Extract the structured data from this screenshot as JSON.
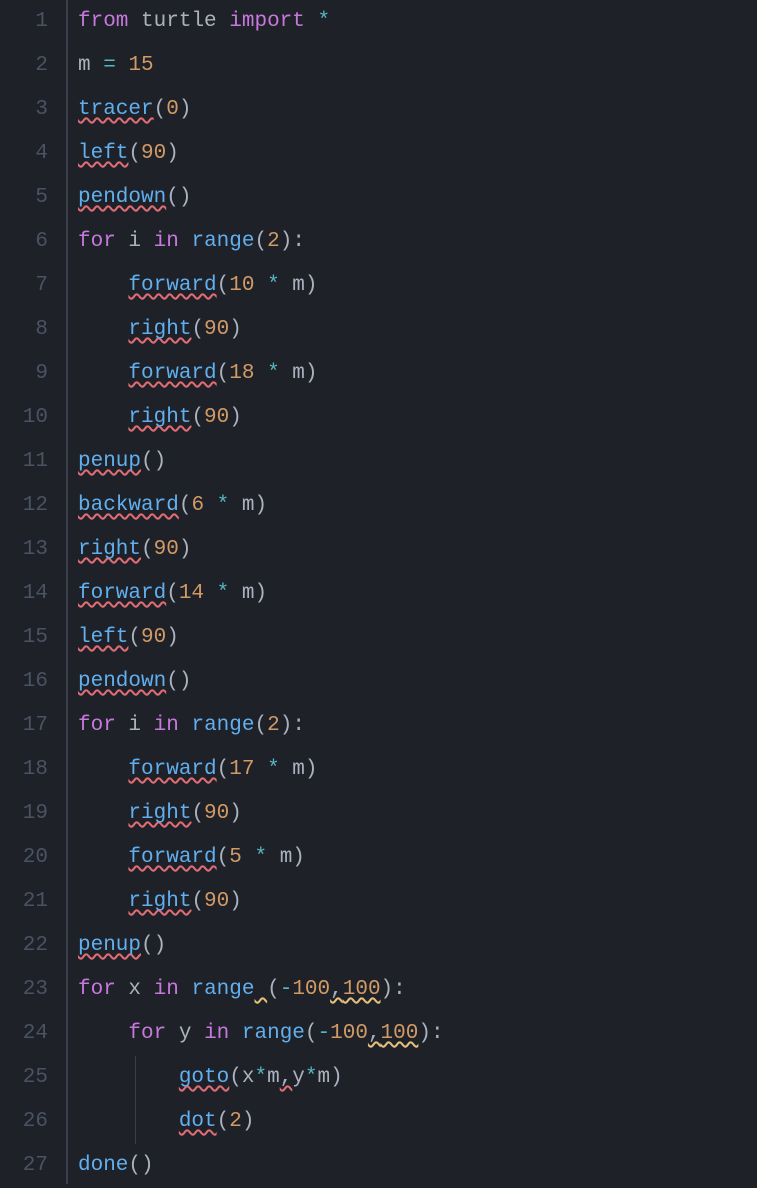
{
  "line_count": 27,
  "lines": {
    "1": {
      "tokens": [
        {
          "t": "from",
          "c": "kw"
        },
        {
          "t": " ",
          "c": "id"
        },
        {
          "t": "turtle",
          "c": "id"
        },
        {
          "t": " ",
          "c": "id"
        },
        {
          "t": "import",
          "c": "kw"
        },
        {
          "t": " ",
          "c": "id"
        },
        {
          "t": "*",
          "c": "op"
        }
      ]
    },
    "2": {
      "tokens": [
        {
          "t": "m",
          "c": "id"
        },
        {
          "t": " ",
          "c": "id"
        },
        {
          "t": "=",
          "c": "op"
        },
        {
          "t": " ",
          "c": "id"
        },
        {
          "t": "15",
          "c": "num"
        }
      ]
    },
    "3": {
      "tokens": [
        {
          "t": "tracer",
          "c": "fn",
          "sq": "red"
        },
        {
          "t": "(",
          "c": "punc"
        },
        {
          "t": "0",
          "c": "num"
        },
        {
          "t": ")",
          "c": "punc"
        }
      ]
    },
    "4": {
      "tokens": [
        {
          "t": "left",
          "c": "fn",
          "sq": "red"
        },
        {
          "t": "(",
          "c": "punc"
        },
        {
          "t": "90",
          "c": "num"
        },
        {
          "t": ")",
          "c": "punc"
        }
      ]
    },
    "5": {
      "tokens": [
        {
          "t": "pendown",
          "c": "fn",
          "sq": "red"
        },
        {
          "t": "(",
          "c": "punc"
        },
        {
          "t": ")",
          "c": "punc"
        }
      ]
    },
    "6": {
      "tokens": [
        {
          "t": "for",
          "c": "kw"
        },
        {
          "t": " ",
          "c": "id"
        },
        {
          "t": "i",
          "c": "id"
        },
        {
          "t": " ",
          "c": "id"
        },
        {
          "t": "in",
          "c": "kw"
        },
        {
          "t": " ",
          "c": "id"
        },
        {
          "t": "range",
          "c": "fn"
        },
        {
          "t": "(",
          "c": "punc"
        },
        {
          "t": "2",
          "c": "num"
        },
        {
          "t": ")",
          "c": "punc"
        },
        {
          "t": ":",
          "c": "punc"
        }
      ]
    },
    "7": {
      "indent": 1,
      "tokens": [
        {
          "t": "forward",
          "c": "fn",
          "sq": "red"
        },
        {
          "t": "(",
          "c": "punc"
        },
        {
          "t": "10",
          "c": "num"
        },
        {
          "t": " ",
          "c": "id"
        },
        {
          "t": "*",
          "c": "op"
        },
        {
          "t": " ",
          "c": "id"
        },
        {
          "t": "m",
          "c": "id"
        },
        {
          "t": ")",
          "c": "punc"
        }
      ]
    },
    "8": {
      "indent": 1,
      "tokens": [
        {
          "t": "right",
          "c": "fn",
          "sq": "red"
        },
        {
          "t": "(",
          "c": "punc"
        },
        {
          "t": "90",
          "c": "num"
        },
        {
          "t": ")",
          "c": "punc"
        }
      ]
    },
    "9": {
      "indent": 1,
      "tokens": [
        {
          "t": "forward",
          "c": "fn",
          "sq": "red"
        },
        {
          "t": "(",
          "c": "punc"
        },
        {
          "t": "18",
          "c": "num"
        },
        {
          "t": " ",
          "c": "id"
        },
        {
          "t": "*",
          "c": "op"
        },
        {
          "t": " ",
          "c": "id"
        },
        {
          "t": "m",
          "c": "id"
        },
        {
          "t": ")",
          "c": "punc"
        }
      ]
    },
    "10": {
      "indent": 1,
      "tokens": [
        {
          "t": "right",
          "c": "fn",
          "sq": "red"
        },
        {
          "t": "(",
          "c": "punc"
        },
        {
          "t": "90",
          "c": "num"
        },
        {
          "t": ")",
          "c": "punc"
        }
      ]
    },
    "11": {
      "tokens": [
        {
          "t": "penup",
          "c": "fn",
          "sq": "red"
        },
        {
          "t": "(",
          "c": "punc"
        },
        {
          "t": ")",
          "c": "punc"
        }
      ]
    },
    "12": {
      "tokens": [
        {
          "t": "backward",
          "c": "fn",
          "sq": "red"
        },
        {
          "t": "(",
          "c": "punc"
        },
        {
          "t": "6",
          "c": "num"
        },
        {
          "t": " ",
          "c": "id"
        },
        {
          "t": "*",
          "c": "op"
        },
        {
          "t": " ",
          "c": "id"
        },
        {
          "t": "m",
          "c": "id"
        },
        {
          "t": ")",
          "c": "punc"
        }
      ]
    },
    "13": {
      "tokens": [
        {
          "t": "right",
          "c": "fn",
          "sq": "red"
        },
        {
          "t": "(",
          "c": "punc"
        },
        {
          "t": "90",
          "c": "num"
        },
        {
          "t": ")",
          "c": "punc"
        }
      ]
    },
    "14": {
      "tokens": [
        {
          "t": "forward",
          "c": "fn",
          "sq": "red"
        },
        {
          "t": "(",
          "c": "punc"
        },
        {
          "t": "14",
          "c": "num"
        },
        {
          "t": " ",
          "c": "id"
        },
        {
          "t": "*",
          "c": "op"
        },
        {
          "t": " ",
          "c": "id"
        },
        {
          "t": "m",
          "c": "id"
        },
        {
          "t": ")",
          "c": "punc"
        }
      ]
    },
    "15": {
      "tokens": [
        {
          "t": "left",
          "c": "fn",
          "sq": "red"
        },
        {
          "t": "(",
          "c": "punc"
        },
        {
          "t": "90",
          "c": "num"
        },
        {
          "t": ")",
          "c": "punc"
        }
      ]
    },
    "16": {
      "tokens": [
        {
          "t": "pendown",
          "c": "fn",
          "sq": "red"
        },
        {
          "t": "(",
          "c": "punc"
        },
        {
          "t": ")",
          "c": "punc"
        }
      ]
    },
    "17": {
      "tokens": [
        {
          "t": "for",
          "c": "kw"
        },
        {
          "t": " ",
          "c": "id"
        },
        {
          "t": "i",
          "c": "id"
        },
        {
          "t": " ",
          "c": "id"
        },
        {
          "t": "in",
          "c": "kw"
        },
        {
          "t": " ",
          "c": "id"
        },
        {
          "t": "range",
          "c": "fn"
        },
        {
          "t": "(",
          "c": "punc"
        },
        {
          "t": "2",
          "c": "num"
        },
        {
          "t": ")",
          "c": "punc"
        },
        {
          "t": ":",
          "c": "punc"
        }
      ]
    },
    "18": {
      "indent": 1,
      "tokens": [
        {
          "t": "forward",
          "c": "fn",
          "sq": "red"
        },
        {
          "t": "(",
          "c": "punc"
        },
        {
          "t": "17",
          "c": "num"
        },
        {
          "t": " ",
          "c": "id"
        },
        {
          "t": "*",
          "c": "op"
        },
        {
          "t": " ",
          "c": "id"
        },
        {
          "t": "m",
          "c": "id"
        },
        {
          "t": ")",
          "c": "punc"
        }
      ]
    },
    "19": {
      "indent": 1,
      "tokens": [
        {
          "t": "right",
          "c": "fn",
          "sq": "red"
        },
        {
          "t": "(",
          "c": "punc"
        },
        {
          "t": "90",
          "c": "num"
        },
        {
          "t": ")",
          "c": "punc"
        }
      ]
    },
    "20": {
      "indent": 1,
      "tokens": [
        {
          "t": "forward",
          "c": "fn",
          "sq": "red"
        },
        {
          "t": "(",
          "c": "punc"
        },
        {
          "t": "5",
          "c": "num"
        },
        {
          "t": " ",
          "c": "id"
        },
        {
          "t": "*",
          "c": "op"
        },
        {
          "t": " ",
          "c": "id"
        },
        {
          "t": "m",
          "c": "id"
        },
        {
          "t": ")",
          "c": "punc"
        }
      ]
    },
    "21": {
      "indent": 1,
      "tokens": [
        {
          "t": "right",
          "c": "fn",
          "sq": "red"
        },
        {
          "t": "(",
          "c": "punc"
        },
        {
          "t": "90",
          "c": "num"
        },
        {
          "t": ")",
          "c": "punc"
        }
      ]
    },
    "22": {
      "tokens": [
        {
          "t": "penup",
          "c": "fn",
          "sq": "red"
        },
        {
          "t": "(",
          "c": "punc"
        },
        {
          "t": ")",
          "c": "punc"
        }
      ]
    },
    "23": {
      "tokens": [
        {
          "t": "for",
          "c": "kw"
        },
        {
          "t": " ",
          "c": "id"
        },
        {
          "t": "x",
          "c": "id"
        },
        {
          "t": " ",
          "c": "id"
        },
        {
          "t": "in",
          "c": "kw"
        },
        {
          "t": " ",
          "c": "id"
        },
        {
          "t": "range",
          "c": "fn"
        },
        {
          "t": " ",
          "c": "id",
          "sq": "yellow"
        },
        {
          "t": "(",
          "c": "punc"
        },
        {
          "t": "-",
          "c": "op"
        },
        {
          "t": "100",
          "c": "num"
        },
        {
          "t": ",",
          "c": "punc",
          "sq": "yellow"
        },
        {
          "t": "100",
          "c": "num",
          "sq": "yellow"
        },
        {
          "t": ")",
          "c": "punc"
        },
        {
          "t": ":",
          "c": "punc"
        }
      ]
    },
    "24": {
      "indent": 1,
      "tokens": [
        {
          "t": "for",
          "c": "kw"
        },
        {
          "t": " ",
          "c": "id"
        },
        {
          "t": "y",
          "c": "id"
        },
        {
          "t": " ",
          "c": "id"
        },
        {
          "t": "in",
          "c": "kw"
        },
        {
          "t": " ",
          "c": "id"
        },
        {
          "t": "range",
          "c": "fn"
        },
        {
          "t": "(",
          "c": "punc"
        },
        {
          "t": "-",
          "c": "op"
        },
        {
          "t": "100",
          "c": "num"
        },
        {
          "t": ",",
          "c": "punc",
          "sq": "yellow"
        },
        {
          "t": "100",
          "c": "num",
          "sq": "yellow"
        },
        {
          "t": ")",
          "c": "punc"
        },
        {
          "t": ":",
          "c": "punc"
        }
      ]
    },
    "25": {
      "indent": 2,
      "guide": true,
      "tokens": [
        {
          "t": "goto",
          "c": "fn",
          "sq": "red"
        },
        {
          "t": "(",
          "c": "punc"
        },
        {
          "t": "x",
          "c": "id"
        },
        {
          "t": "*",
          "c": "op"
        },
        {
          "t": "m",
          "c": "id"
        },
        {
          "t": ",",
          "c": "punc",
          "sq": "red"
        },
        {
          "t": "y",
          "c": "id"
        },
        {
          "t": "*",
          "c": "op"
        },
        {
          "t": "m",
          "c": "id"
        },
        {
          "t": ")",
          "c": "punc"
        }
      ]
    },
    "26": {
      "indent": 2,
      "guide": true,
      "tokens": [
        {
          "t": "dot",
          "c": "fn",
          "sq": "red"
        },
        {
          "t": "(",
          "c": "punc"
        },
        {
          "t": "2",
          "c": "num"
        },
        {
          "t": ")",
          "c": "punc"
        }
      ]
    },
    "27": {
      "tokens": [
        {
          "t": "done",
          "c": "fn"
        },
        {
          "t": "(",
          "c": "punc"
        },
        {
          "t": ")",
          "c": "punc"
        }
      ]
    }
  }
}
